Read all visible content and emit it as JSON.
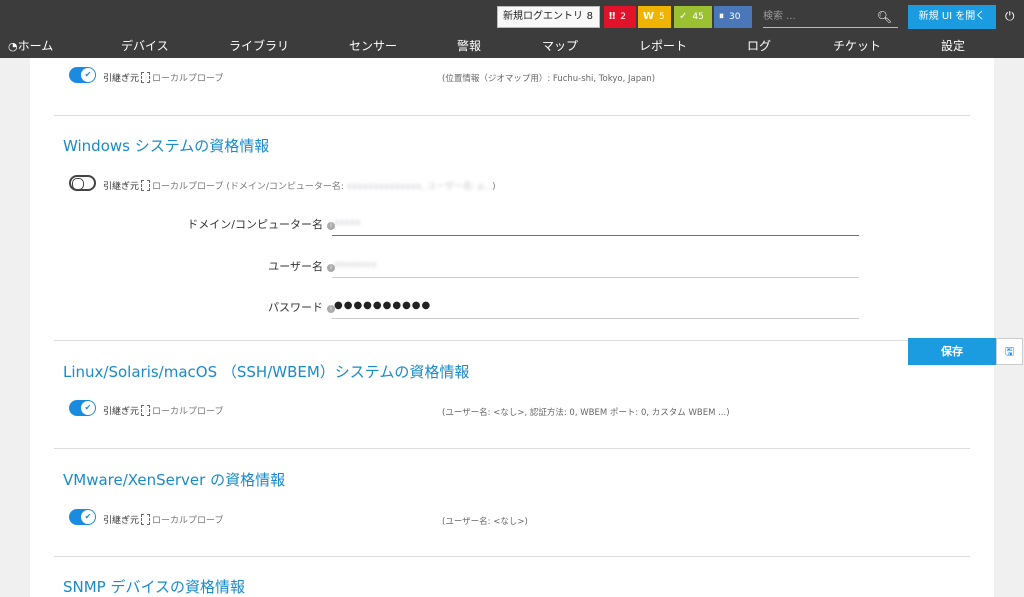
{
  "header": {
    "new_log": {
      "label": "新規ログエントリ",
      "count": "8"
    },
    "badges": [
      {
        "icon": "‼",
        "count": "2",
        "color": "#e0132b"
      },
      {
        "icon": "W",
        "count": "5",
        "color": "#f0b400"
      },
      {
        "icon": "✓",
        "count": "45",
        "color": "#9bc132"
      },
      {
        "icon": "⏸",
        "count": "30",
        "color": "#4a77b8"
      }
    ],
    "search_placeholder": "検索 ...",
    "new_ui": "新規 UI を開く"
  },
  "nav": {
    "home": "ホーム",
    "items": [
      "デバイス",
      "ライブラリ",
      "センサー",
      "警報",
      "マップ",
      "レポート",
      "ログ",
      "チケット",
      "設定"
    ]
  },
  "common": {
    "inherit_label": "引継ぎ元",
    "probe_label": "ローカルプローブ"
  },
  "location": {
    "summary": "(位置情報（ジオマップ用）: Fuchu-shi, Tokyo, Japan)"
  },
  "windows": {
    "title": "Windows システムの資格情報",
    "inherit_suffix": "(ドメイン/コンピューター名:",
    "inherit_blur": "xxxxxxxxxxxxxx, ユーザー名: p...",
    "inherit_end": ")",
    "domain_label": "ドメイン/コンピューター名",
    "domain_value": "xxxxx",
    "user_label": "ユーザー名",
    "user_value": "xxxxxxxx",
    "password_label": "パスワード",
    "password_value": "●●●●●●●●●●"
  },
  "linux": {
    "title": "Linux/Solaris/macOS （SSH/WBEM）システムの資格情報",
    "summary": "(ユーザー名: <なし>, 認証方法: 0, WBEM ポート: 0, カスタム WBEM ...)"
  },
  "vmware": {
    "title": "VMware/XenServer の資格情報",
    "summary": "(ユーザー名: <なし>)"
  },
  "snmp": {
    "title": "SNMP デバイスの資格情報"
  },
  "actions": {
    "save": "保存"
  }
}
